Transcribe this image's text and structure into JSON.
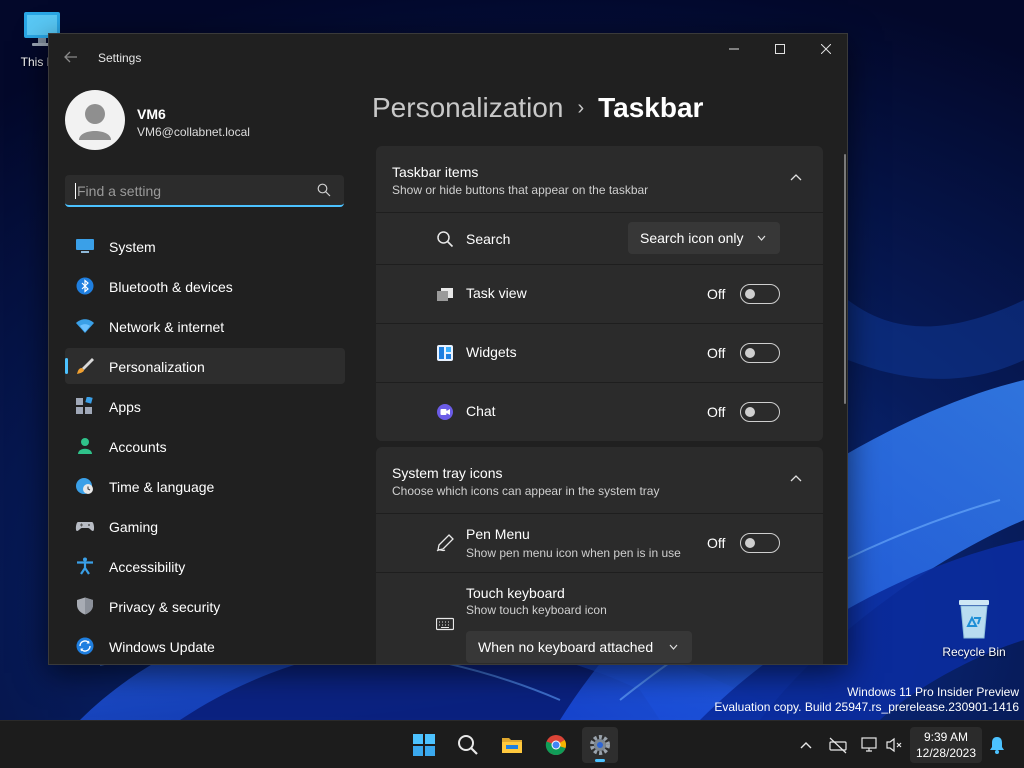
{
  "desktop": {
    "icons": [
      {
        "label": "This PC"
      },
      {
        "label": "Recycle Bin"
      }
    ],
    "watermark": {
      "line1": "Windows 11 Pro Insider Preview",
      "line2": "Evaluation copy. Build 25947.rs_prerelease.230901-1416"
    }
  },
  "window": {
    "title": "Settings",
    "controls": {
      "minimize": "─",
      "maximize": "☐",
      "close": "✕"
    }
  },
  "profile": {
    "name": "VM6",
    "email": "VM6@collabnet.local"
  },
  "search": {
    "placeholder": "Find a setting",
    "value": ""
  },
  "nav": {
    "items": [
      {
        "label": "System",
        "icon": "monitor-icon"
      },
      {
        "label": "Bluetooth & devices",
        "icon": "bluetooth-icon"
      },
      {
        "label": "Network & internet",
        "icon": "wifi-icon"
      },
      {
        "label": "Personalization",
        "icon": "brush-icon",
        "selected": true
      },
      {
        "label": "Apps",
        "icon": "apps-icon"
      },
      {
        "label": "Accounts",
        "icon": "person-icon"
      },
      {
        "label": "Time & language",
        "icon": "globe-clock-icon"
      },
      {
        "label": "Gaming",
        "icon": "gamepad-icon"
      },
      {
        "label": "Accessibility",
        "icon": "accessibility-icon"
      },
      {
        "label": "Privacy & security",
        "icon": "shield-icon"
      },
      {
        "label": "Windows Update",
        "icon": "update-icon"
      }
    ]
  },
  "breadcrumb": {
    "parent": "Personalization",
    "separator": "›",
    "current": "Taskbar"
  },
  "taskbar_items": {
    "title": "Taskbar items",
    "subtitle": "Show or hide buttons that appear on the taskbar",
    "search": {
      "label": "Search",
      "value": "Search icon only"
    },
    "task_view": {
      "label": "Task view",
      "state": "Off"
    },
    "widgets": {
      "label": "Widgets",
      "state": "Off"
    },
    "chat": {
      "label": "Chat",
      "state": "Off"
    }
  },
  "system_tray": {
    "title": "System tray icons",
    "subtitle": "Choose which icons can appear in the system tray",
    "pen_menu": {
      "label": "Pen Menu",
      "sub": "Show pen menu icon when pen is in use",
      "state": "Off"
    },
    "touch_keyboard": {
      "label": "Touch keyboard",
      "sub": "Show touch keyboard icon",
      "value": "When no keyboard attached"
    }
  },
  "taskbar": {
    "apps": [
      "start-icon",
      "search-icon",
      "file-explorer-icon",
      "chrome-icon",
      "settings-icon"
    ],
    "tray_icons": [
      "chevron-up-icon",
      "network-off-icon",
      "display-icon",
      "volume-muted-icon"
    ],
    "time": "9:39 AM",
    "date": "12/28/2023"
  },
  "colors": {
    "accent": "#4cc2ff",
    "window_bg": "#202020",
    "card_bg": "#2b2b2b"
  }
}
